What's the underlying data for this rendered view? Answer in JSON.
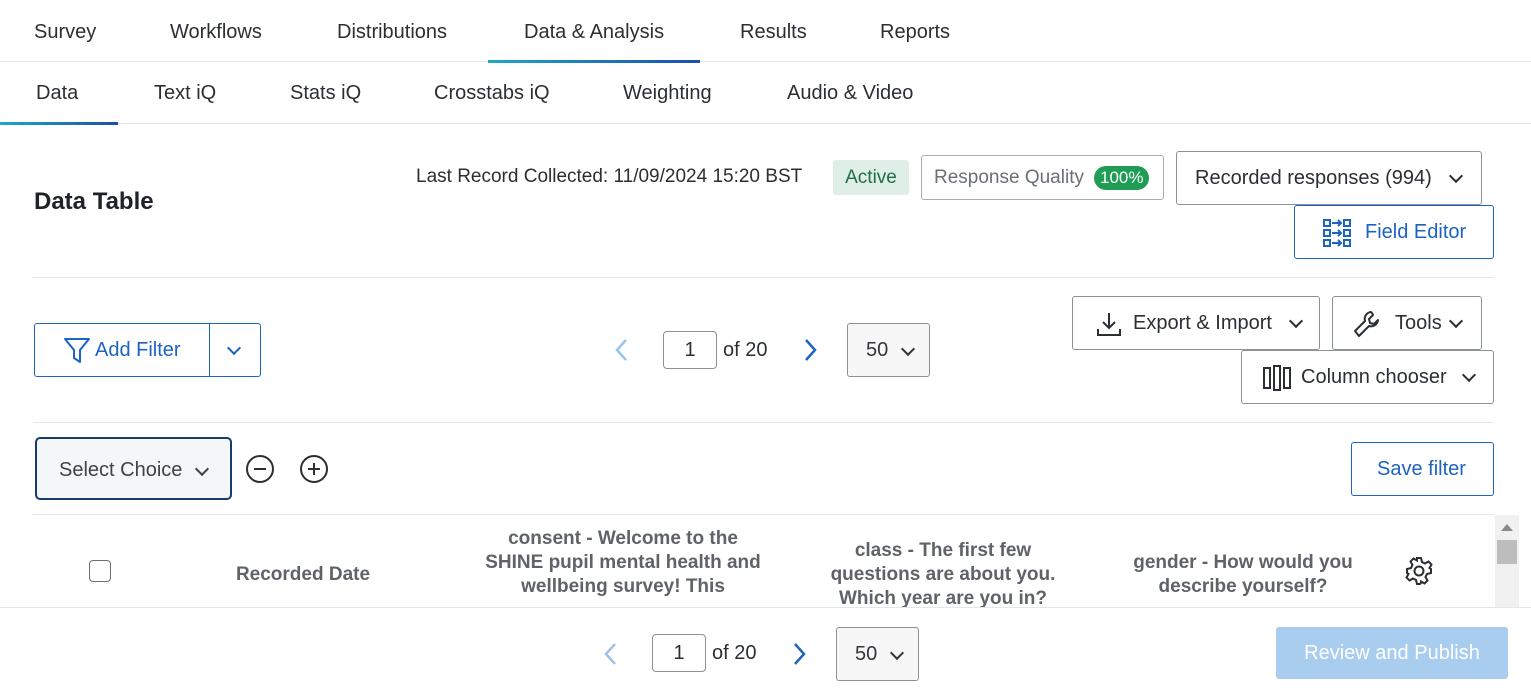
{
  "top_tabs": [
    "Survey",
    "Workflows",
    "Distributions",
    "Data & Analysis",
    "Results",
    "Reports"
  ],
  "sub_tabs": [
    "Data",
    "Text iQ",
    "Stats iQ",
    "Crosstabs iQ",
    "Weighting",
    "Audio & Video"
  ],
  "header": {
    "title": "Data Table",
    "last_record": "Last Record Collected: 11/09/2024 15:20 BST",
    "status": "Active",
    "response_quality_label": "Response Quality",
    "response_quality_value": "100%",
    "recorded_responses": "Recorded responses (994)",
    "field_editor": "Field Editor"
  },
  "toolbar": {
    "add_filter": "Add Filter",
    "export_import": "Export & Import",
    "tools": "Tools",
    "column_chooser": "Column chooser",
    "save_filter": "Save filter",
    "select_choice": "Select Choice"
  },
  "pager": {
    "page": "1",
    "of_text": "of 20",
    "page_size": "50"
  },
  "table": {
    "columns": [
      "Recorded Date",
      "consent - Welcome to the SHINE pupil mental health and wellbeing survey! This",
      "class - The first few questions are about you. Which year are you in?",
      "gender - How would you describe yourself?"
    ]
  },
  "footer": {
    "page": "1",
    "of_text": "of 20",
    "page_size": "50",
    "publish": "Review and Publish"
  },
  "colors": {
    "accent_blue": "#1d63c2",
    "active_green": "#1f9d55",
    "publish_disabled": "#a9cdef"
  }
}
